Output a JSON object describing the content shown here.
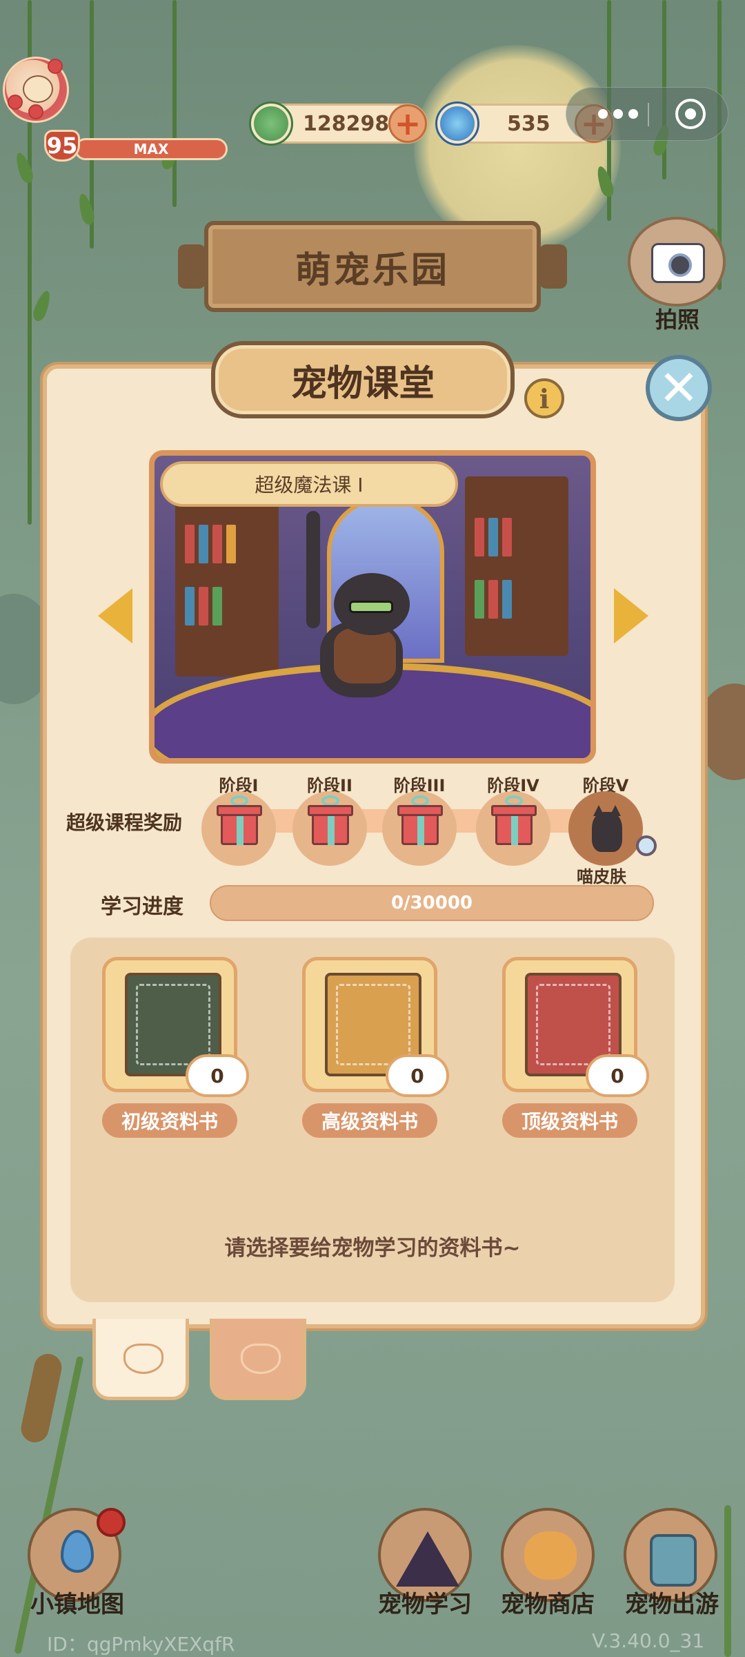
{
  "player": {
    "level": "95",
    "level_bar": "MAX"
  },
  "currencies": [
    {
      "icon": "clover-icon",
      "value": "128298",
      "color": "#5aa05a"
    },
    {
      "icon": "swirl-gem-icon",
      "value": "535",
      "color": "#4a90d0"
    }
  ],
  "header_sign": {
    "title": "萌宠乐园"
  },
  "camera": {
    "label": "拍照"
  },
  "panel": {
    "title": "宠物课堂",
    "info_icon": "i",
    "course_title": "超级魔法课 I"
  },
  "rewards": {
    "label": "超级课程奖励",
    "stages": [
      {
        "label": "阶段I",
        "type": "gift-icon"
      },
      {
        "label": "阶段II",
        "type": "gift-icon"
      },
      {
        "label": "阶段III",
        "type": "gift-icon"
      },
      {
        "label": "阶段IV",
        "type": "gift-icon"
      },
      {
        "label": "阶段V",
        "type": "cat-skin-icon",
        "reward_name": "喵皮肤"
      }
    ]
  },
  "progress": {
    "label": "学习进度",
    "text": "0/30000",
    "fraction": 0
  },
  "books": [
    {
      "name": "初级资料书",
      "count": "0",
      "color": "#4f5e48"
    },
    {
      "name": "高级资料书",
      "count": "0",
      "color": "#d9a050"
    },
    {
      "name": "顶级资料书",
      "count": "0",
      "color": "#c0504a"
    }
  ],
  "hint": "请选择要给宠物学习的资料书~",
  "bottom_nav": [
    {
      "label": "小镇地图",
      "icon": "map-pin-icon"
    },
    {
      "label": "宠物学习",
      "icon": "wizard-hat-icon"
    },
    {
      "label": "宠物商店",
      "icon": "shiba-dog-icon"
    },
    {
      "label": "宠物出游",
      "icon": "backpack-icon"
    }
  ],
  "footer": {
    "id_text": "ID：qgPmkyXEXqfR",
    "version": "V.3.40.0_31"
  }
}
